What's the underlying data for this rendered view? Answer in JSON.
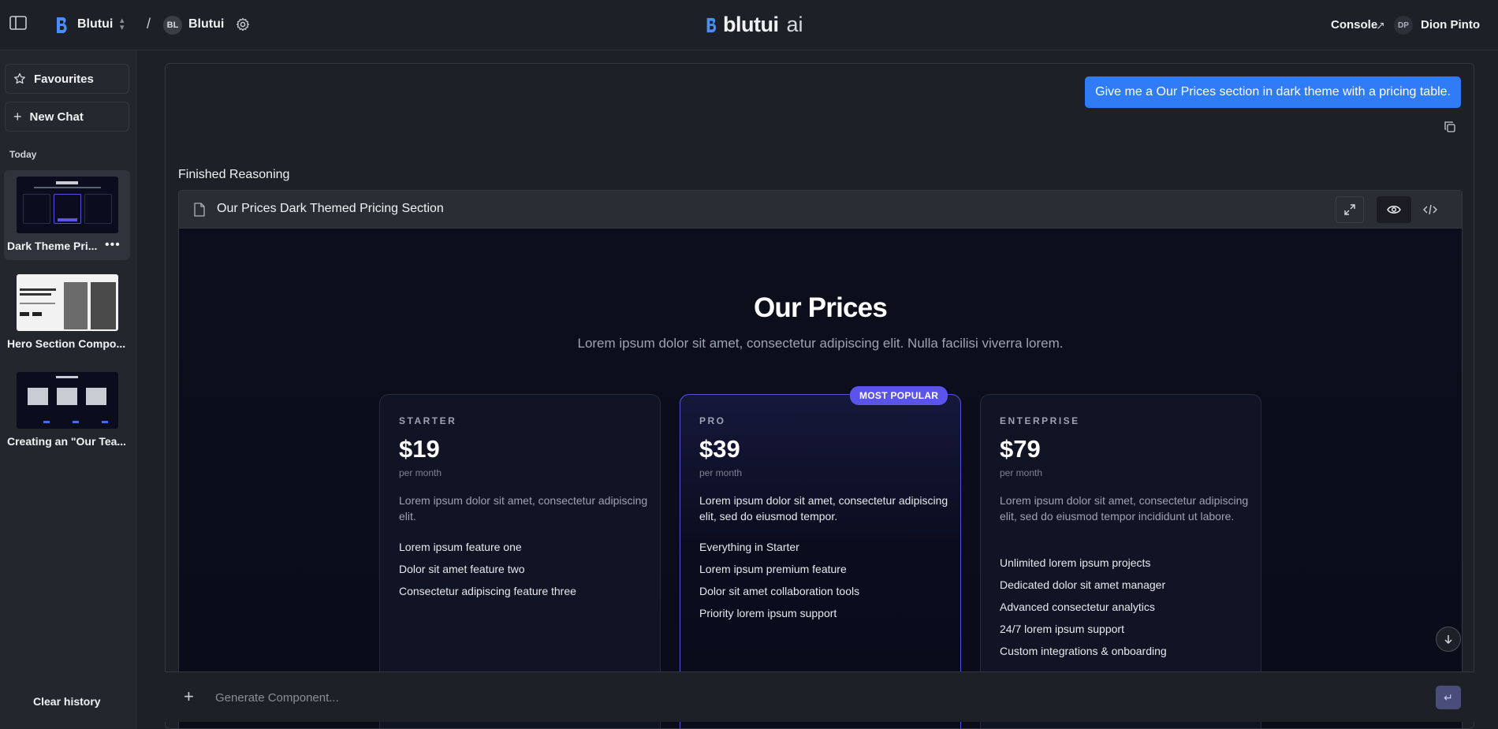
{
  "header": {
    "workspace_name": "Blutui",
    "project_initials": "BL",
    "project_name": "Blutui",
    "brand_name": "blutui",
    "brand_suffix": "ai",
    "console_label": "Console",
    "user_initials": "DP",
    "user_name": "Dion Pinto"
  },
  "sidebar": {
    "favourites_label": "Favourites",
    "new_chat_label": "New Chat",
    "section_today": "Today",
    "history": [
      {
        "label": "Dark Theme Pri...",
        "active": true
      },
      {
        "label": "Hero Section Compo...",
        "active": false
      },
      {
        "label": "Creating an \"Our Tea...",
        "active": false
      }
    ],
    "clear_history_label": "Clear history"
  },
  "chat": {
    "user_prompt": "Give me a Our Prices section in dark theme with a pricing table.",
    "status": "Finished Reasoning",
    "artifact_title": "Our Prices Dark Themed Pricing Section"
  },
  "preview": {
    "title": "Our Prices",
    "subtitle": "Lorem ipsum dolor sit amet, consectetur adipiscing elit. Nulla facilisi viverra lorem.",
    "badge": "MOST POPULAR",
    "plans": [
      {
        "tier": "STARTER",
        "price": "$19",
        "period": "per month",
        "description": "Lorem ipsum dolor sit amet, consectetur adipiscing elit.",
        "features": [
          "Lorem ipsum feature one",
          "Dolor sit amet feature two",
          "Consectetur adipiscing feature three"
        ]
      },
      {
        "tier": "PRO",
        "price": "$39",
        "period": "per month",
        "description": "Lorem ipsum dolor sit amet, consectetur adipiscing elit, sed do eiusmod tempor.",
        "features": [
          "Everything in Starter",
          "Lorem ipsum premium feature",
          "Dolor sit amet collaboration tools",
          "Priority lorem ipsum support"
        ]
      },
      {
        "tier": "ENTERPRISE",
        "price": "$79",
        "period": "per month",
        "description": "Lorem ipsum dolor sit amet, consectetur adipiscing elit, sed do eiusmod tempor incididunt ut labore.",
        "features": [
          "Unlimited lorem ipsum projects",
          "Dedicated dolor sit amet manager",
          "Advanced consectetur analytics",
          "24/7 lorem ipsum support",
          "Custom integrations & onboarding"
        ]
      }
    ]
  },
  "composer": {
    "placeholder": "Generate Component..."
  },
  "colors": {
    "accent": "#2f7cf6",
    "pro_accent": "#5b54ea",
    "background": "#1d2026"
  }
}
